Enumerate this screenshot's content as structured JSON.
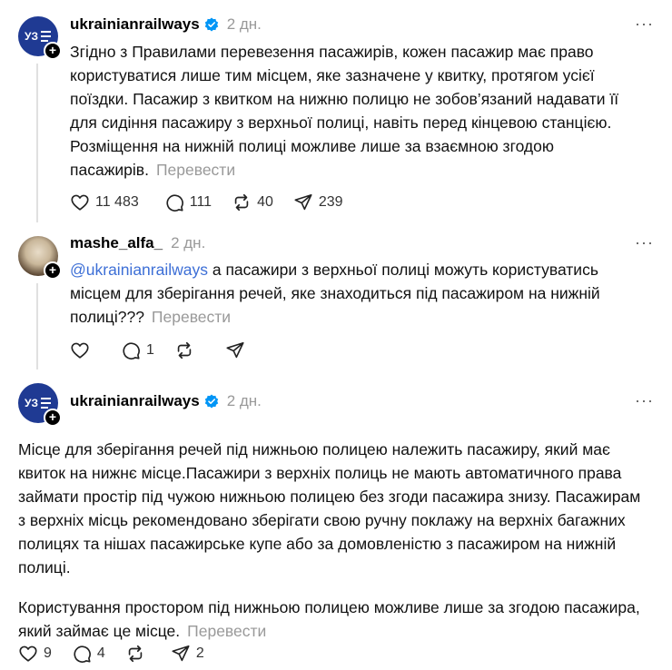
{
  "posts": [
    {
      "username": "ukrainianrailways",
      "verified": true,
      "time": "2 дн.",
      "more": "···",
      "text": "Згідно з Правилами перевезення пасажирів, кожен пасажир має право користуватися лише тим місцем, яке зазначене у квитку, протягом усієї поїздки. Пасажир з квитком на нижню полицю не зобов’язаний надавати її для сидіння пасажиру з верхньої полиці, навіть перед кінцевою станцією. Розміщення на нижній полиці можливе лише за взаємною згодою пасажирів.",
      "translate": "Перевести",
      "likes": "11 483",
      "comments": "111",
      "reposts": "40",
      "shares": "239"
    },
    {
      "username": "mashe_alfa_",
      "verified": false,
      "time": "2 дн.",
      "more": "···",
      "mention": "@ukrainianrailways",
      "text": " а пасажири з верхньої полиці можуть користуватись місцем для зберігання речей, яке знаходиться під пасажиром на нижній полиці???",
      "translate": "Перевести",
      "likes": "",
      "comments": "1",
      "reposts": "",
      "shares": ""
    },
    {
      "username": "ukrainianrailways",
      "verified": true,
      "time": "2 дн.",
      "more": "···",
      "text_p1": "Місце для зберігання речей під нижньою полицею належить пасажиру, який має квиток на нижнє місце.Пасажири з верхніх полиць не мають автоматичного права займати простір під чужою нижньою полицею без згоди пасажира знизу. Пасажирам з верхніх місць рекомендовано зберігати свою ручну поклажу на верхніх багажних полицях та нішах пасажирське купе або за домовленістю з пасажиром на нижній полиці.",
      "text_p2": "Користування простором під нижньою полицею можливе лише за згодою пасажира, який займає це місце.",
      "translate": "Перевести",
      "likes": "9",
      "comments": "4",
      "reposts": "",
      "shares": "2"
    }
  ],
  "avatar_logo_text": "УЗ",
  "colors": {
    "brand": "#1f3a93",
    "verified": "#0095f6",
    "mention": "#3d6fd6",
    "muted": "#999999"
  }
}
